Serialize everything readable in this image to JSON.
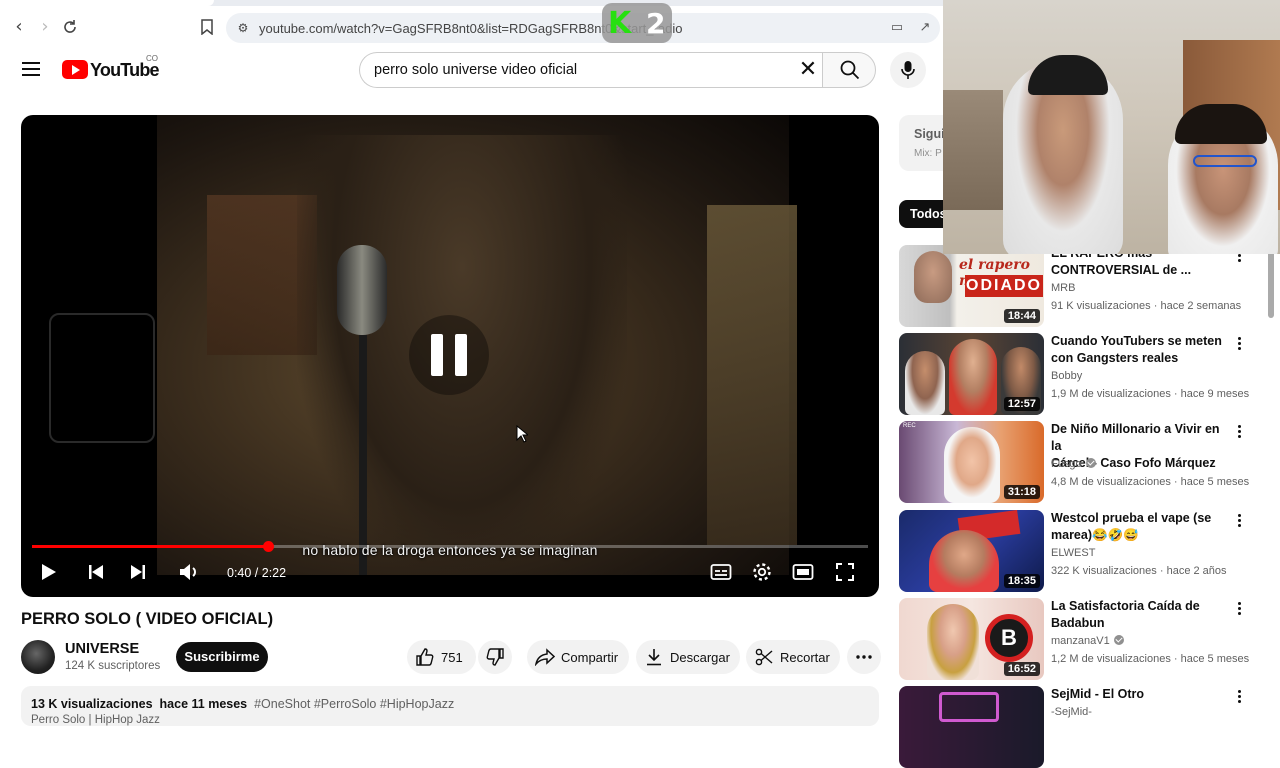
{
  "browser": {
    "url": "youtube.com/watch?v=GagSFRB8nt0&list=RDGagSFRB8nt0&start_radio",
    "overlay_badge": {
      "letter": "K",
      "number": "2"
    }
  },
  "header": {
    "logo_text": "YouTube",
    "region": "CO",
    "search_query": "perro solo universe video oficial"
  },
  "player": {
    "subtitle": "no hablo de la droga entonces ya se imaginan",
    "current_time": "0:40",
    "duration": "2:22",
    "time_display": "0:40 / 2:22",
    "progress_fraction": 0.282,
    "accent_color": "#ff0000"
  },
  "video": {
    "title": "PERRO SOLO ( VIDEO OFICIAL)",
    "channel": "UNIVERSE",
    "subscribers": "124 K suscriptores",
    "subscribe_label": "Suscribirme",
    "likes": "751",
    "share_label": "Compartir",
    "download_label": "Descargar",
    "clip_label": "Recortar",
    "views": "13 K visualizaciones",
    "age": "hace 11 meses",
    "hashtags": "#OneShot #PerroSolo #HipHopJazz",
    "desc_line2": "Perro Solo | HipHop Jazz"
  },
  "sidebar": {
    "mix_title": "Sigui",
    "mix_sub": "Mix: P",
    "chip_all": "Todos",
    "recommendations": [
      {
        "title_line1": "EL RAPERO más",
        "title_line2": "CONTROVERSIAL de ...",
        "channel": "MRB",
        "verified": false,
        "views": "91 K visualizaciones",
        "age": "hace 2 semanas",
        "duration": "18:44",
        "thumb_text": "el rapero mas ODIADO"
      },
      {
        "title_line1": "Cuando YouTubers se meten",
        "title_line2": "con Gangsters reales",
        "channel": "Bobby",
        "verified": false,
        "views": "1,9 M de visualizaciones",
        "age": "hace 9 meses",
        "duration": "12:57"
      },
      {
        "title_line1": "De Niño Millonario a Vivir en la",
        "title_line2": "Cárcel - Caso Fofo Márquez",
        "channel": "Fusgo",
        "verified": true,
        "views": "4,8 M de visualizaciones",
        "age": "hace 5 meses",
        "duration": "31:18",
        "thumb_text": "REC"
      },
      {
        "title_line1": "Westcol prueba el vape (se",
        "title_line2": "marea)😂🤣😅",
        "channel": "ELWEST",
        "verified": false,
        "views": "322 K visualizaciones",
        "age": "hace 2 años",
        "duration": "18:35"
      },
      {
        "title_line1": "La Satisfactoria Caída de",
        "title_line2": "Badabun",
        "channel": "manzanaV1",
        "verified": true,
        "views": "1,2 M de visualizaciones",
        "age": "hace 5 meses",
        "duration": "16:52",
        "thumb_text": "B"
      },
      {
        "title_line1": "SejMid - El Otro",
        "title_line2": "",
        "channel": "-SejMid-",
        "verified": false,
        "views": "",
        "age": "",
        "duration": ""
      }
    ]
  }
}
